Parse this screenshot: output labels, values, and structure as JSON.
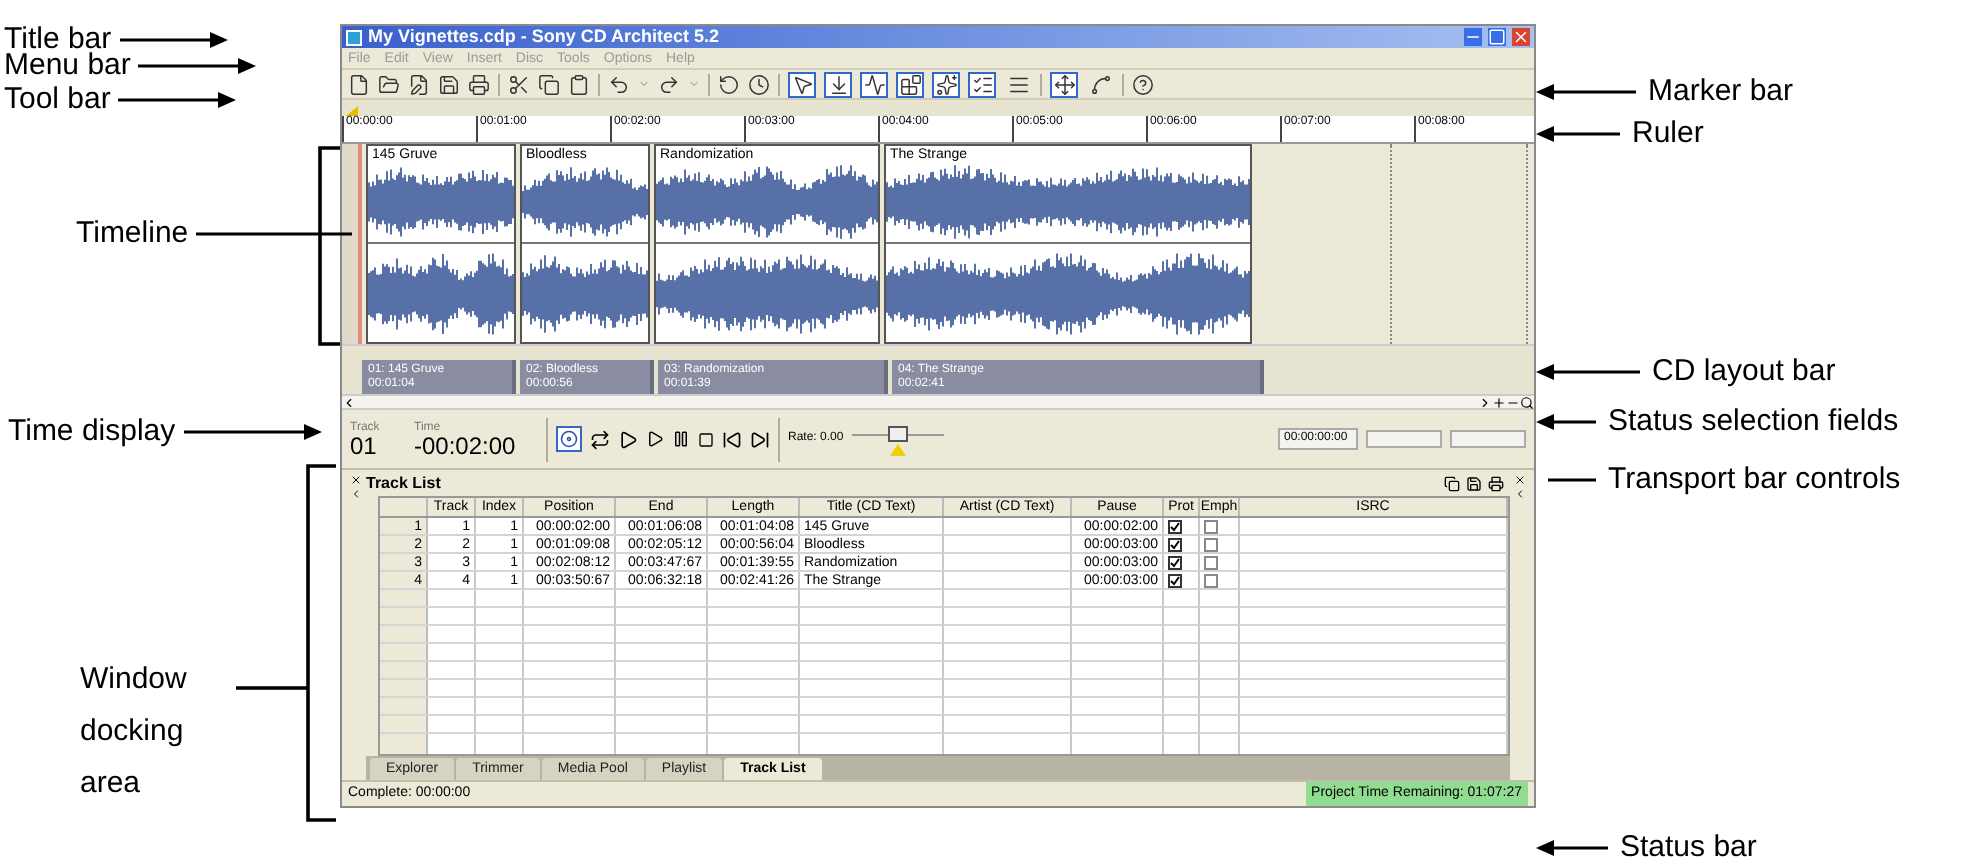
{
  "annotations": {
    "left": [
      "Title bar",
      "Menu bar",
      "Tool bar",
      "Timeline",
      "Time display",
      "Window docking area"
    ],
    "right": [
      "Marker bar",
      "Ruler",
      "CD layout bar",
      "Status selection fields",
      "Transport bar controls",
      "Status bar"
    ]
  },
  "window": {
    "title": "My Vignettes.cdp - Sony CD Architect 5.2"
  },
  "menu": [
    "File",
    "Edit",
    "View",
    "Insert",
    "Disc",
    "Tools",
    "Options",
    "Help"
  ],
  "toolbar": {
    "toggles": [
      {
        "on": true
      },
      {
        "on": true
      },
      {
        "on": true
      },
      {
        "on": true
      },
      {
        "on": true
      },
      {
        "on": true
      },
      {
        "on": false
      },
      {
        "on": true
      },
      {
        "on": false
      }
    ]
  },
  "ruler": [
    "00:00:00",
    "00:01:00",
    "00:02:00",
    "00:03:00",
    "00:04:00",
    "00:05:00",
    "00:06:00",
    "00:07:00",
    "00:08:00"
  ],
  "clips": [
    {
      "title": "145 Gruve"
    },
    {
      "title": "Bloodless"
    },
    {
      "title": "Randomization"
    },
    {
      "title": "The Strange"
    }
  ],
  "cd_layout": [
    {
      "label": "01: 145 Gruve",
      "time": "00:01:04"
    },
    {
      "label": "02: Bloodless",
      "time": "00:00:56"
    },
    {
      "label": "03: Randomization",
      "time": "00:01:39"
    },
    {
      "label": "04: The Strange",
      "time": "00:02:41"
    }
  ],
  "transport": {
    "track_label": "Track",
    "track": "01",
    "time_label": "Time",
    "time": "-00:02:00",
    "rate": "Rate: 0.00",
    "rate_slider": {
      "level": 0.5
    },
    "status_field": "00:00:00:00"
  },
  "track_list": {
    "title": "Track List",
    "columns": [
      "Track",
      "Index",
      "Position",
      "End",
      "Length",
      "Title (CD Text)",
      "Artist (CD Text)",
      "Pause",
      "Prot",
      "Emph",
      "ISRC"
    ],
    "rows": [
      {
        "number": "1",
        "track": "1",
        "index": "1",
        "position": "00:00:02:00",
        "end": "00:01:06:08",
        "length": "00:01:04:08",
        "title": "145 Gruve",
        "pause": "00:00:02:00",
        "prot": true,
        "emph": false
      },
      {
        "number": "2",
        "track": "2",
        "index": "1",
        "position": "00:01:09:08",
        "end": "00:02:05:12",
        "length": "00:00:56:04",
        "title": "Bloodless",
        "pause": "00:00:03:00",
        "prot": true,
        "emph": false
      },
      {
        "number": "3",
        "track": "3",
        "index": "1",
        "position": "00:02:08:12",
        "end": "00:03:47:67",
        "length": "00:01:39:55",
        "title": "Randomization",
        "pause": "00:00:03:00",
        "prot": true,
        "emph": false
      },
      {
        "number": "4",
        "track": "4",
        "index": "1",
        "position": "00:03:50:67",
        "end": "00:06:32:18",
        "length": "00:02:41:26",
        "title": "The Strange",
        "pause": "00:00:03:00",
        "prot": true,
        "emph": false
      }
    ]
  },
  "tabs": [
    {
      "label": "Explorer",
      "selected": false
    },
    {
      "label": "Trimmer",
      "selected": false
    },
    {
      "label": "Media Pool",
      "selected": false
    },
    {
      "label": "Playlist",
      "selected": false
    },
    {
      "label": "Track List",
      "selected": true
    }
  ],
  "status_bar": {
    "left": "Complete: 00:00:00",
    "right": "Project Time Remaining: 01:07:27"
  }
}
